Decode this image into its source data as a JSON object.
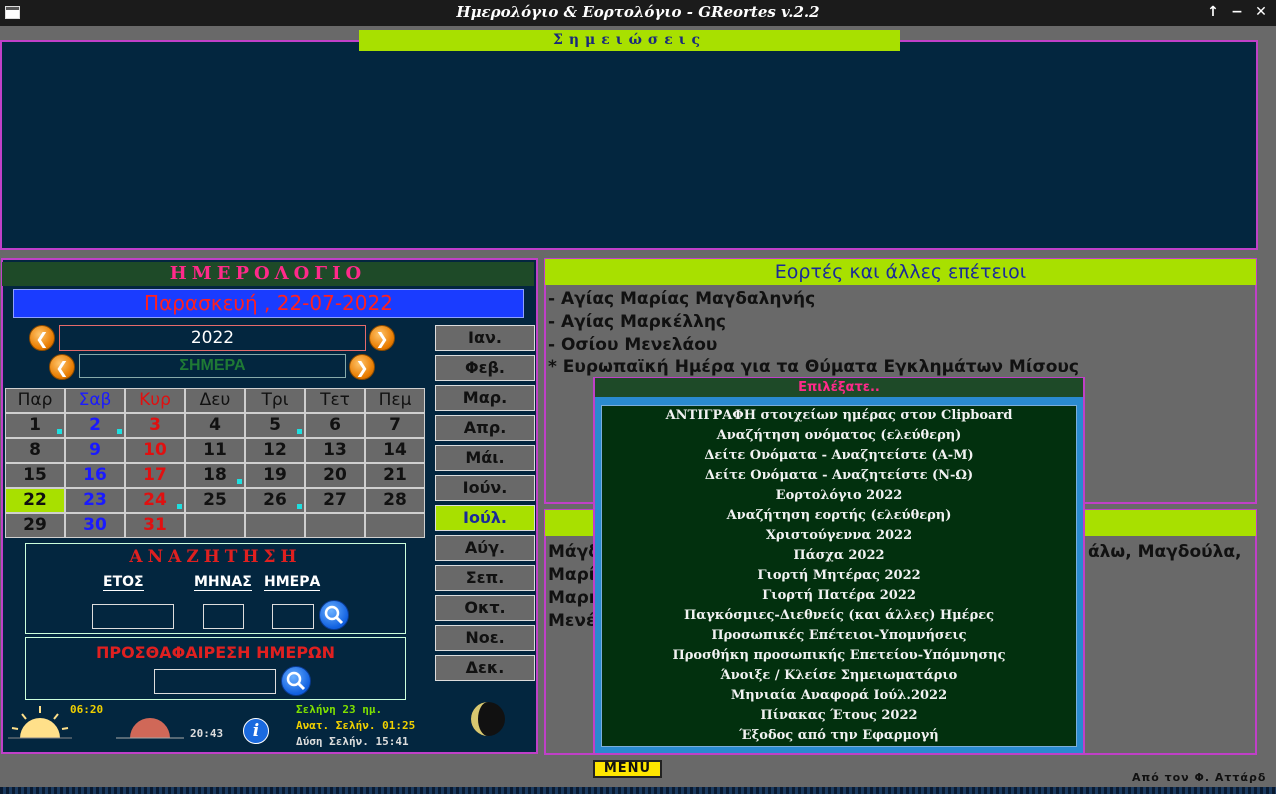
{
  "window": {
    "title": "Ημερολόγιο & Εορτολόγιο - GReortes v.2.2",
    "maximize_glyph": "↑",
    "minimize_glyph": "−",
    "close_glyph": "✕"
  },
  "notes": {
    "title": "Σημειώσεις"
  },
  "calendar": {
    "title": "ΗΜΕΡΟΛΟΓΙΟ",
    "current_date": "Παρασκευή , 22-07-2022",
    "year": "2022",
    "today_label": "ΣΗΜΕΡΑ",
    "prev_glyph": "❮",
    "next_glyph": "❯",
    "weekdays": [
      "Παρ",
      "Σαβ",
      "Κυρ",
      "Δευ",
      "Τρι",
      "Τετ",
      "Πεμ"
    ],
    "weeks": [
      [
        "1",
        "2",
        "3",
        "4",
        "5",
        "6",
        "7"
      ],
      [
        "8",
        "9",
        "10",
        "11",
        "12",
        "13",
        "14"
      ],
      [
        "15",
        "16",
        "17",
        "18",
        "19",
        "20",
        "21"
      ],
      [
        "22",
        "23",
        "24",
        "25",
        "26",
        "27",
        "28"
      ],
      [
        "29",
        "30",
        "31",
        "",
        "",
        "",
        ""
      ]
    ],
    "selected_day": "22",
    "marked_days": [
      "1",
      "2",
      "5",
      "18",
      "24",
      "26"
    ]
  },
  "months": [
    "Ιαν.",
    "Φεβ.",
    "Μαρ.",
    "Απρ.",
    "Μάι.",
    "Ιούν.",
    "Ιούλ.",
    "Αύγ.",
    "Σεπ.",
    "Οκτ.",
    "Νοε.",
    "Δεκ."
  ],
  "active_month": "Ιούλ.",
  "search": {
    "title": "ΑΝΑΖΗΤΗΣΗ",
    "year_label": "ΕΤΟΣ",
    "month_label": "ΜΗΝΑΣ",
    "day_label": "ΗΜΕΡΑ",
    "year_value": "",
    "month_value": "",
    "day_value": ""
  },
  "add_subtract": {
    "title": "ΠΡΟΣΘΑΦΑΙΡΕΣΗ ΗΜΕΡΩΝ",
    "value": ""
  },
  "sun": {
    "sunrise": "06:20",
    "sunset": "20:43"
  },
  "moon": {
    "age": "Σελήνη 23 ημ.",
    "rise": "Ανατ. Σελήν. 01:25",
    "set": "Δύση Σελήν. 15:41"
  },
  "info_glyph": "i",
  "feasts": {
    "title": "Εορτές και άλλες επέτειοι",
    "items": [
      "- Αγίας Μαρίας Μαγδαληνής",
      "- Αγίας Μαρκέλλης",
      "- Οσίου Μενελάου",
      "* Ευρωπαϊκή Ημέρα για τα Θύματα Εγκλημάτων Μίσους"
    ]
  },
  "names": {
    "left_fragments": [
      "Μάγδ",
      "Μαρί",
      "Μαρκ",
      "Μενέ"
    ],
    "right_fragment": "άλω, Μαγδούλα,"
  },
  "popup": {
    "title": "Επιλέξατε..",
    "items": [
      "ΑΝΤΙΓΡΑΦΗ στοιχείων ημέρας στον Clipboard",
      "Αναζήτηση ονόματος (ελεύθερη)",
      "Δείτε Ονόματα - Αναζητείστε (Α-Μ)",
      "Δείτε Ονόματα - Αναζητείστε (Ν-Ω)",
      "Εορτολόγιο 2022",
      "Αναζήτηση εορτής (ελεύθερη)",
      "Χριστούγεννα 2022",
      "Πάσχα 2022",
      "Γιορτή Μητέρας 2022",
      "Γιορτή Πατέρα 2022",
      "Παγκόσμιες-Διεθνείς (και άλλες) Ημέρες",
      "Προσωπικές Επέτειοι-Υπομνήσεις",
      "Προσθήκη προσωπικής Επετείου-Υπόμνησης",
      "Άνοιξε / Κλείσε Σημειωματάριο",
      "Μηνιαία Αναφορά Ιούλ.2022",
      "Πίνακας Έτους 2022",
      "Έξοδος από την Εφαρμογή"
    ]
  },
  "menu_button": "MENU",
  "author": "Από τον Φ. Αττάρδ",
  "colors": {
    "background": "#696969",
    "panel": "#03263f",
    "accent_green": "#a8e000",
    "border_magenta": "#c040c8",
    "sunday_red": "#e01010",
    "saturday_blue": "#1a1aff"
  }
}
